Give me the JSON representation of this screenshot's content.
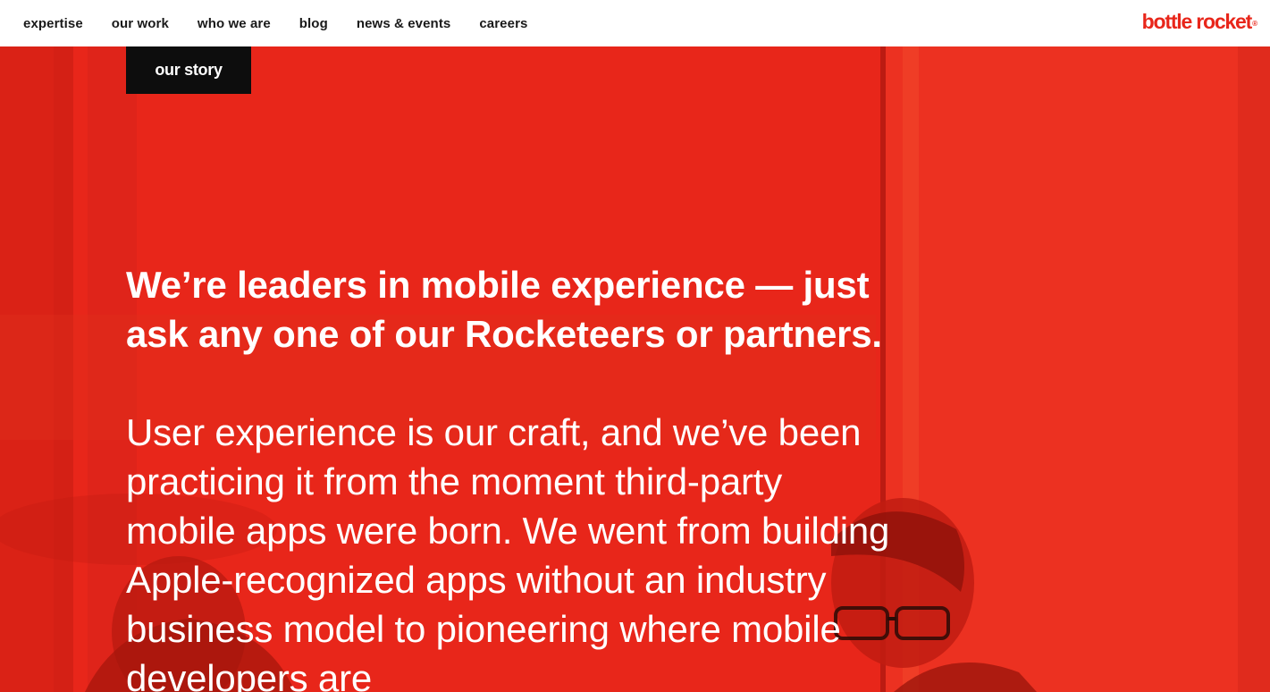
{
  "nav": {
    "items": [
      {
        "label": "expertise"
      },
      {
        "label": "our work"
      },
      {
        "label": "who we are"
      },
      {
        "label": "blog"
      },
      {
        "label": "news & events"
      },
      {
        "label": "careers"
      }
    ],
    "logo_text": "bottle rocket",
    "logo_mark": "®"
  },
  "hero": {
    "badge_label": "our story",
    "headline": "We’re leaders in mobile experience — just ask any one of our Rocketeers or partners.",
    "body": "User experience is our craft, and we’ve been practicing it from the moment third-party mobile apps were born. We went from building Apple-recognized apps without an industry business model to pioneering where mobile developers are"
  },
  "colors": {
    "brand_red": "#e8261a",
    "nav_bg": "#ffffff",
    "badge_bg": "#0d0d0d",
    "text_light": "#ffffff"
  }
}
